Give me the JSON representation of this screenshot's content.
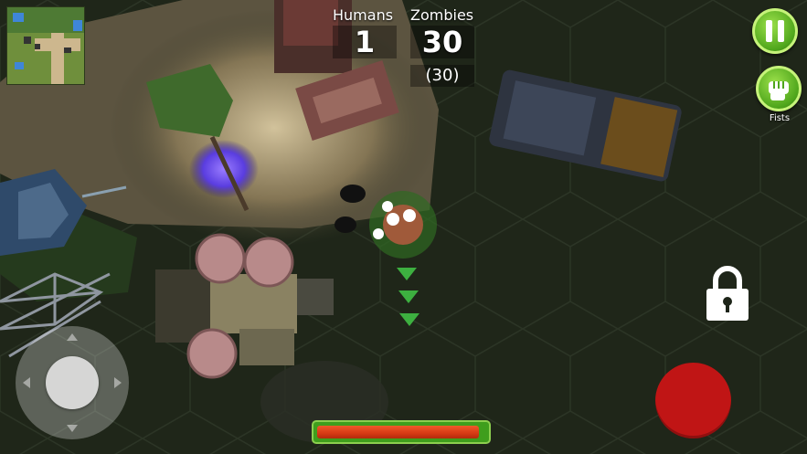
{
  "hud": {
    "humans_label": "Humans",
    "humans_count": "1",
    "zombies_label": "Zombies",
    "zombies_count": "30",
    "zombies_total": "(30)",
    "weapon_label": "Fists"
  },
  "player": {
    "health_fraction": 0.96
  },
  "colors": {
    "accent_green": "#4ea51b",
    "fire_red": "#c01515",
    "health_red": "#d63a14",
    "health_frame": "#3f9e1d",
    "portal_purple": "#6a4df0"
  },
  "icons": [
    "pause-icon",
    "fist-icon",
    "lock-icon",
    "move-arrow-icon"
  ]
}
